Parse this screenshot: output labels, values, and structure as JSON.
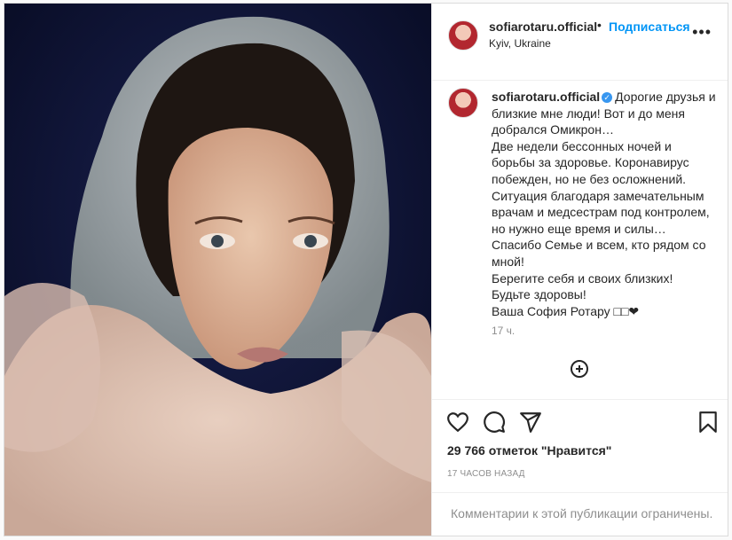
{
  "post": {
    "username": "sofiarotaru.official",
    "dot": "•",
    "follow_label": "Подписаться",
    "location": "Kyiv, Ukraine",
    "more_label": "•••",
    "photo_alt": "portrait"
  },
  "caption": {
    "username": "sofiarotaru.official",
    "verified_mark": "✓",
    "lines": [
      "Дорогие друзья и",
      "близкие мне люди! Вот и до меня",
      "добрался Омикрон…",
      "Две недели бессонных ночей и",
      "борьбы за здоровье. Коронавирус",
      "побежден, но не без осложнений.",
      "Ситуация благодаря замечательным",
      "врачам и медсестрам под контролем,",
      "но нужно еще время и силы…",
      "Спасибо Семье и всем, кто рядом со",
      "мной!",
      "Берегите себя и своих близких!",
      "Будьте здоровы!",
      "Ваша София Ротару □□❤"
    ],
    "ago": "17 ч."
  },
  "actions": {
    "icons": [
      "heart-icon",
      "comment-icon",
      "share-icon",
      "bookmark-icon",
      "plus-circle-icon"
    ]
  },
  "stats": {
    "likes": "29 766 отметок \"Нравится\"",
    "time": "17 ЧАСОВ НАЗАД"
  },
  "comments": {
    "notice": "Комментарии к этой публикации ограничены."
  },
  "colors": {
    "link": "#0095f6",
    "text": "#262626",
    "muted": "#8e8e8e",
    "border": "#dbdbdb"
  }
}
